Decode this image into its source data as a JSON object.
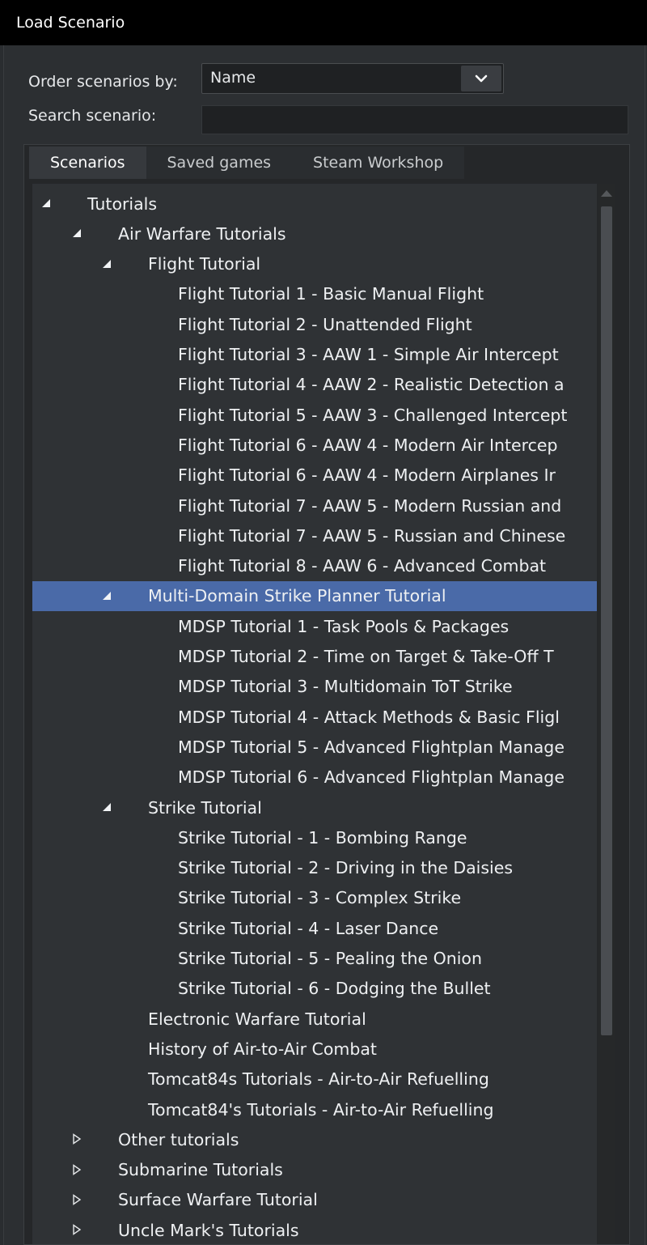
{
  "window": {
    "title": "Load Scenario"
  },
  "controls": {
    "order_label": "Order scenarios by:",
    "order_value": "Name",
    "search_label": "Search scenario:",
    "search_value": ""
  },
  "tabs": [
    {
      "label": "Scenarios",
      "active": true
    },
    {
      "label": "Saved games",
      "active": false
    },
    {
      "label": "Steam Workshop",
      "active": false
    }
  ],
  "tree": [
    {
      "label": "Tutorials",
      "level": 0,
      "toggle": "expanded"
    },
    {
      "label": "Air Warfare Tutorials",
      "level": 1,
      "toggle": "expanded"
    },
    {
      "label": "Flight Tutorial",
      "level": 2,
      "toggle": "expanded"
    },
    {
      "label": "Flight Tutorial 1 - Basic Manual Flight",
      "level": 3,
      "toggle": "none"
    },
    {
      "label": "Flight Tutorial 2 - Unattended Flight",
      "level": 3,
      "toggle": "none"
    },
    {
      "label": "Flight Tutorial 3 - AAW 1 - Simple Air Intercept",
      "level": 3,
      "toggle": "none"
    },
    {
      "label": "Flight Tutorial 4 - AAW 2 - Realistic Detection a",
      "level": 3,
      "toggle": "none"
    },
    {
      "label": "Flight Tutorial 5 - AAW 3 - Challenged Intercept",
      "level": 3,
      "toggle": "none"
    },
    {
      "label": "Flight Tutorial 6 - AAW 4 - Modern Air Intercep",
      "level": 3,
      "toggle": "none"
    },
    {
      "label": "Flight Tutorial 6 - AAW 4 - Modern Airplanes Ir",
      "level": 3,
      "toggle": "none"
    },
    {
      "label": "Flight Tutorial 7 - AAW 5 - Modern Russian and",
      "level": 3,
      "toggle": "none"
    },
    {
      "label": "Flight Tutorial 7 - AAW 5 - Russian and Chinese",
      "level": 3,
      "toggle": "none"
    },
    {
      "label": "Flight Tutorial 8 - AAW 6 - Advanced Combat",
      "level": 3,
      "toggle": "none"
    },
    {
      "label": "Multi-Domain Strike Planner Tutorial",
      "level": 2,
      "toggle": "expanded",
      "selected": true
    },
    {
      "label": "MDSP Tutorial 1 - Task Pools & Packages",
      "level": 3,
      "toggle": "none"
    },
    {
      "label": "MDSP Tutorial 2 - Time on Target & Take-Off T",
      "level": 3,
      "toggle": "none"
    },
    {
      "label": "MDSP Tutorial 3 - Multidomain ToT Strike",
      "level": 3,
      "toggle": "none"
    },
    {
      "label": "MDSP Tutorial 4 - Attack Methods & Basic Fligl",
      "level": 3,
      "toggle": "none"
    },
    {
      "label": "MDSP Tutorial 5 - Advanced Flightplan Manage",
      "level": 3,
      "toggle": "none"
    },
    {
      "label": "MDSP Tutorial 6 - Advanced Flightplan Manage",
      "level": 3,
      "toggle": "none"
    },
    {
      "label": "Strike Tutorial",
      "level": 2,
      "toggle": "expanded"
    },
    {
      "label": "Strike Tutorial - 1 - Bombing Range",
      "level": 3,
      "toggle": "none"
    },
    {
      "label": "Strike Tutorial - 2 - Driving in the Daisies",
      "level": 3,
      "toggle": "none"
    },
    {
      "label": "Strike Tutorial - 3 - Complex Strike",
      "level": 3,
      "toggle": "none"
    },
    {
      "label": "Strike Tutorial - 4 - Laser Dance",
      "level": 3,
      "toggle": "none"
    },
    {
      "label": "Strike Tutorial - 5 - Pealing the Onion",
      "level": 3,
      "toggle": "none"
    },
    {
      "label": "Strike Tutorial - 6 - Dodging the Bullet",
      "level": 3,
      "toggle": "none"
    },
    {
      "label": "Electronic Warfare Tutorial",
      "level": 2,
      "toggle": "none"
    },
    {
      "label": "History of Air-to-Air Combat",
      "level": 2,
      "toggle": "none"
    },
    {
      "label": "Tomcat84s Tutorials - Air-to-Air Refuelling",
      "level": 2,
      "toggle": "none"
    },
    {
      "label": "Tomcat84's Tutorials - Air-to-Air Refuelling",
      "level": 2,
      "toggle": "none"
    },
    {
      "label": "Other tutorials",
      "level": 1,
      "toggle": "collapsed"
    },
    {
      "label": "Submarine Tutorials",
      "level": 1,
      "toggle": "collapsed"
    },
    {
      "label": "Surface Warfare Tutorial",
      "level": 1,
      "toggle": "collapsed"
    },
    {
      "label": "Uncle Mark's Tutorials",
      "level": 1,
      "toggle": "collapsed"
    }
  ],
  "colors": {
    "selection": "#4a6aa8",
    "titlebar": "#000000",
    "panel": "#2c2f32"
  }
}
